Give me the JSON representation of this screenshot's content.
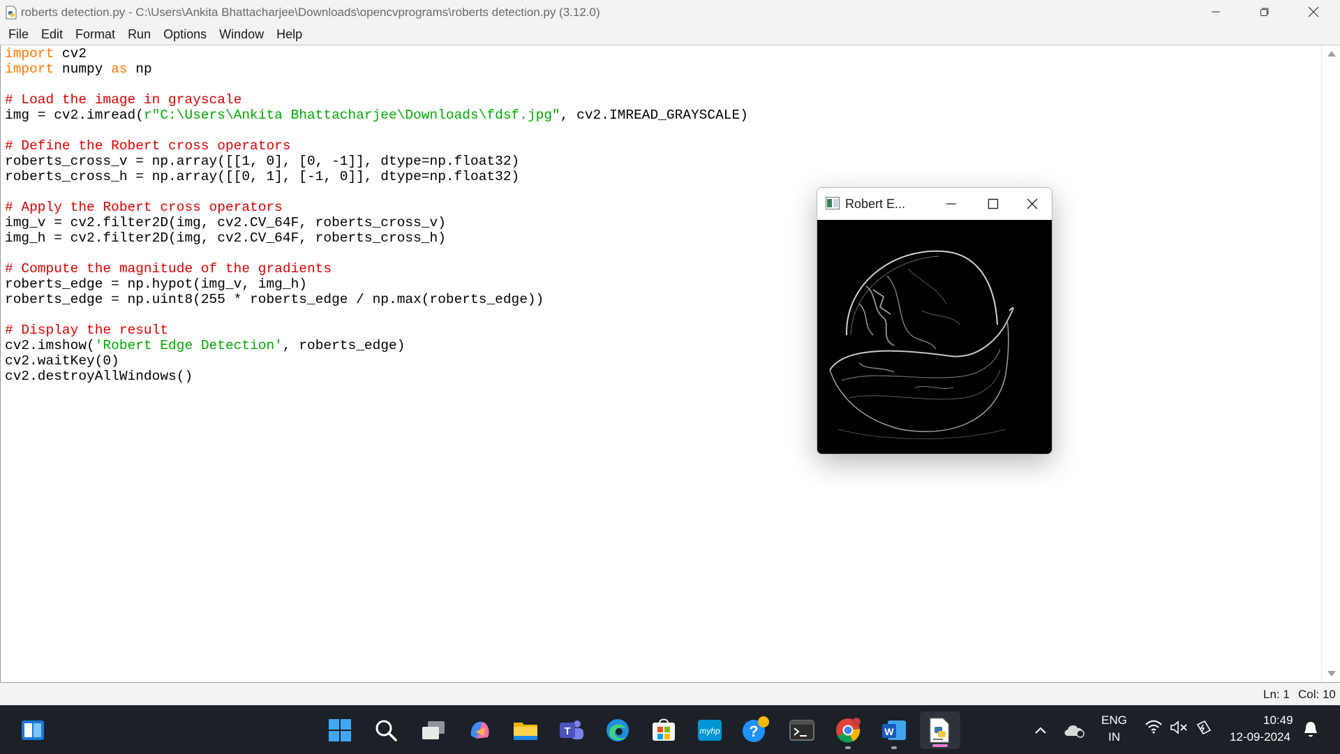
{
  "window": {
    "title": "roberts detection.py - C:\\Users\\Ankita Bhattacharjee\\Downloads\\opencvprograms\\roberts detection.py (3.12.0)"
  },
  "menu": [
    "File",
    "Edit",
    "Format",
    "Run",
    "Options",
    "Window",
    "Help"
  ],
  "code": {
    "line1_kw": "import",
    "line1_rest": " cv2",
    "line2_kw": "import",
    "line2_mid": " numpy ",
    "line2_kw2": "as",
    "line2_rest": " np",
    "line4": "# Load the image in grayscale",
    "line5_a": "img = cv2.imread(",
    "line5_str": "r\"C:\\Users\\Ankita Bhattacharjee\\Downloads\\fdsf.jpg\"",
    "line5_b": ", cv2.IMREAD_GRAYSCALE)",
    "line7": "# Define the Robert cross operators",
    "line8": "roberts_cross_v = np.array([[1, 0], [0, -1]], dtype=np.float32)",
    "line9": "roberts_cross_h = np.array([[0, 1], [-1, 0]], dtype=np.float32)",
    "line11": "# Apply the Robert cross operators",
    "line12": "img_v = cv2.filter2D(img, cv2.CV_64F, roberts_cross_v)",
    "line13": "img_h = cv2.filter2D(img, cv2.CV_64F, roberts_cross_h)",
    "line15": "# Compute the magnitude of the gradients",
    "line16": "roberts_edge = np.hypot(img_v, img_h)",
    "line17": "roberts_edge = np.uint8(255 * roberts_edge / np.max(roberts_edge))",
    "line19": "# Display the result",
    "line20_a": "cv2.imshow(",
    "line20_str": "'Robert Edge Detection'",
    "line20_b": ", roberts_edge)",
    "line21": "cv2.waitKey(0)",
    "line22": "cv2.destroyAllWindows()"
  },
  "status": {
    "ln": "Ln: 1",
    "col": "Col: 10"
  },
  "cv_window": {
    "title": "Robert E..."
  },
  "taskbar": {
    "lang_top": "ENG",
    "lang_bottom": "IN",
    "time": "10:49",
    "date": "12-09-2024"
  },
  "colors": {
    "keyword": "#ff7700",
    "comment": "#dd0000",
    "string": "#00aa00",
    "taskbar": "#1c2027"
  }
}
